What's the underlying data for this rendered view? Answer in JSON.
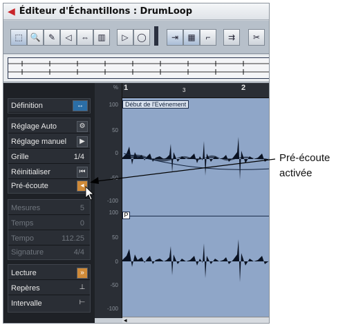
{
  "window": {
    "title": "Éditeur d'Échantillons : DrumLoop"
  },
  "toolbar": {
    "icons": [
      "range-select",
      "zoom",
      "draw",
      "speaker",
      "hitpoint",
      "grid",
      "play",
      "loop",
      "snap",
      "cycle",
      "sync",
      "insert",
      "cut"
    ]
  },
  "timeline": {
    "bar_1": "1",
    "beat_3": "3",
    "bar_2": "2",
    "event_start_label": "Début de l'Evénement"
  },
  "scale_top": [
    "%",
    "100",
    "50",
    "0",
    "-50",
    "-100"
  ],
  "scale_bottom": [
    "100",
    "50",
    "0",
    "-50",
    "-100"
  ],
  "panel": {
    "definition": "Définition",
    "reglage_auto": "Réglage Auto",
    "reglage_manuel": "Réglage manuel",
    "grille": "Grille",
    "grille_val": "1/4",
    "reinitialiser": "Réinitialiser",
    "pre_ecoute": "Pré-écoute",
    "mesures": "Mesures",
    "mesures_val": "5",
    "temps": "Temps",
    "temps_val": "0",
    "tempo": "Tempo",
    "tempo_val": "112.25",
    "signature": "Signature",
    "signature_val": "4/4",
    "lecture": "Lecture",
    "reperes": "Repères",
    "intervalle": "Intervalle"
  },
  "marker_p": "P",
  "annotation": {
    "line1": "Pré-écoute",
    "line2": "activée"
  },
  "colors": {
    "title_red": "#c8252a",
    "wave_bg": "#8fa6c8",
    "panel_bg": "#1e2126",
    "accent_orange": "#cf8a38"
  }
}
